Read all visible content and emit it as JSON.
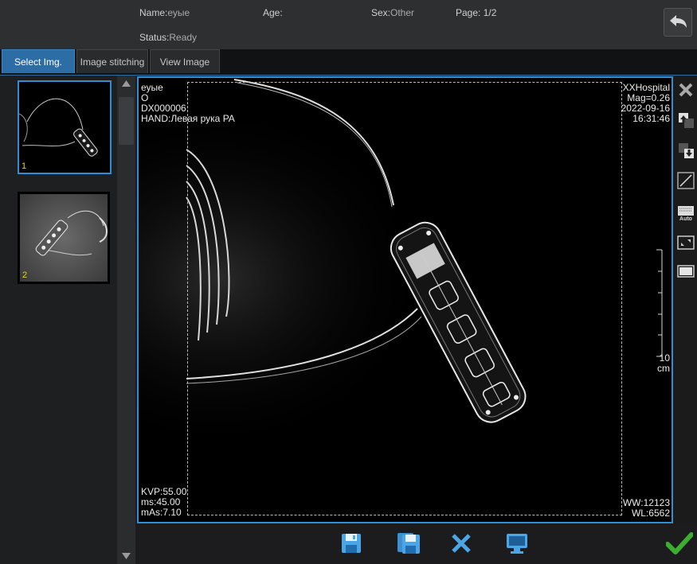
{
  "header": {
    "name_label": "Name:",
    "name_value": "еуые",
    "age_label": "Age:",
    "age_value": "",
    "sex_label": "Sex:",
    "sex_value": "Other",
    "page_label": "Page:",
    "page_value": "1/2",
    "status_label": "Status:",
    "status_value": "Ready"
  },
  "tabs": [
    {
      "label": "Select Img.",
      "active": true
    },
    {
      "label": "Image stitching",
      "active": false
    },
    {
      "label": "View Image",
      "active": false
    }
  ],
  "thumbnails": [
    {
      "number": "1",
      "selected": true
    },
    {
      "number": "2",
      "selected": false
    }
  ],
  "viewer": {
    "top_left": [
      "еуые",
      "O",
      "DX000006",
      "HAND:Левая рука PA"
    ],
    "top_right": [
      "XXHospital",
      "Mag=0.26",
      "2022-09-16",
      "16:31:46"
    ],
    "scale_value": "10",
    "scale_unit": "cm",
    "bottom_left": [
      "KVP:55.00",
      "ms:45.00",
      "mAs:7.10"
    ],
    "bottom_right": [
      "WW:12123",
      "WL:6562"
    ]
  },
  "right_tools": [
    {
      "icon": "close-icon"
    },
    {
      "icon": "move-up-icon"
    },
    {
      "icon": "move-down-icon"
    },
    {
      "icon": "curve-icon"
    },
    {
      "icon": "auto-window-icon",
      "label": "Auto"
    },
    {
      "icon": "resize-icon"
    },
    {
      "icon": "rectangle-icon"
    }
  ],
  "bottom_buttons": [
    {
      "icon": "save-icon"
    },
    {
      "icon": "save-all-icon"
    },
    {
      "icon": "delete-icon"
    },
    {
      "icon": "monitor-icon"
    }
  ],
  "confirm": {
    "icon": "checkmark-icon"
  },
  "colors": {
    "accent": "#2f8fd6",
    "tab_active": "#2d6da6",
    "confirm": "#3cae2e",
    "icon_blue": "#4aa6e6"
  }
}
